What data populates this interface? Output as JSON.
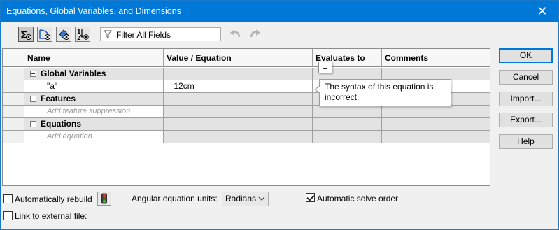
{
  "window": {
    "title": "Equations, Global Variables, and Dimensions"
  },
  "toolbar": {
    "tools": [
      {
        "icon": "sigma-equation-view-icon"
      },
      {
        "icon": "sketch-equation-view-icon"
      },
      {
        "icon": "dimension-view-icon"
      },
      {
        "icon": "ordered-view-icon"
      }
    ],
    "filter_placeholder": "Filter All Fields"
  },
  "grid": {
    "columns": [
      "Name",
      "Value / Equation",
      "Evaluates to",
      "Comments"
    ],
    "sections": [
      {
        "label": "Global Variables",
        "rows": [
          {
            "name": "\"a\"",
            "value": "= 12cm",
            "evaluates": "",
            "comments": ""
          }
        ]
      },
      {
        "label": "Features",
        "hint": "Add feature suppression"
      },
      {
        "label": "Equations",
        "hint": "Add equation"
      }
    ]
  },
  "tooltip": {
    "badge": "=",
    "message": "The syntax of this equation is incorrect."
  },
  "buttons": {
    "ok": "OK",
    "cancel": "Cancel",
    "import": "Import...",
    "export": "Export...",
    "help": "Help"
  },
  "options": {
    "auto_rebuild": {
      "label": "Automatically rebuild",
      "checked": false
    },
    "link_external": {
      "label": "Link to external file:",
      "checked": false
    },
    "angular_label": "Angular equation units:",
    "angular_value": "Radians",
    "auto_solve": {
      "label": "Automatic solve order",
      "checked": true
    }
  }
}
